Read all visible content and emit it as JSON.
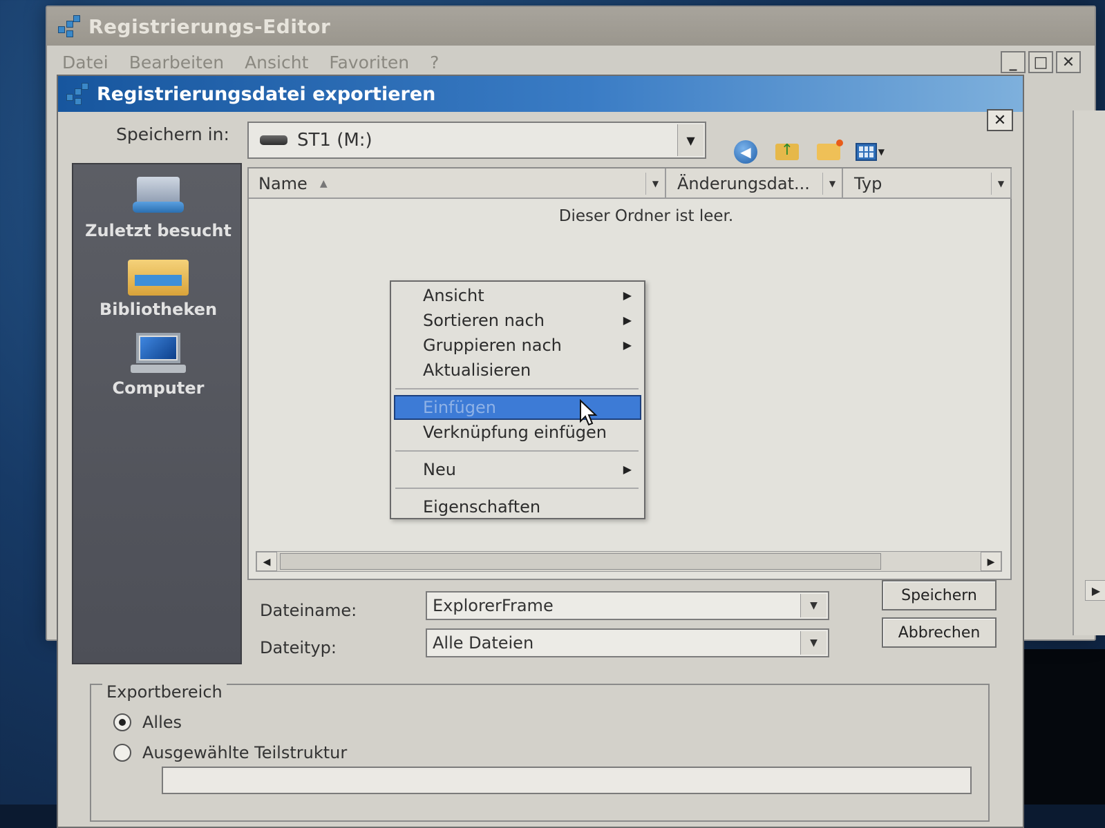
{
  "window": {
    "title": "Registrierungs-Editor",
    "menu": [
      "Datei",
      "Bearbeiten",
      "Ansicht",
      "Favoriten",
      "?"
    ],
    "controls": [
      "_",
      "□",
      "✕"
    ]
  },
  "dialog": {
    "title": "Registrierungsdatei exportieren",
    "close": "✕",
    "save_in_label": "Speichern in:",
    "location": "ST1 (M:)",
    "places": [
      {
        "label": "Zuletzt besucht",
        "icon": "recent-places-icon"
      },
      {
        "label": "Bibliotheken",
        "icon": "libraries-icon"
      },
      {
        "label": "Computer",
        "icon": "computer-icon"
      }
    ],
    "columns": [
      "Name",
      "Änderungsdat...",
      "Typ"
    ],
    "empty_text": "Dieser Ordner ist leer.",
    "context_menu": {
      "items": [
        {
          "label": "Ansicht",
          "submenu": true
        },
        {
          "label": "Sortieren nach",
          "submenu": true
        },
        {
          "label": "Gruppieren nach",
          "submenu": true
        },
        {
          "label": "Aktualisieren",
          "submenu": false
        },
        {
          "label": "Einfügen",
          "submenu": false,
          "disabled": true,
          "highlighted": true
        },
        {
          "label": "Verknüpfung einfügen",
          "submenu": false
        },
        {
          "label": "Neu",
          "submenu": true
        },
        {
          "label": "Eigenschaften",
          "submenu": false
        }
      ]
    },
    "filename_label": "Dateiname:",
    "filename_value": "ExplorerFrame",
    "filetype_label": "Dateityp:",
    "filetype_value": "Alle Dateien",
    "save_button": "Speichern",
    "cancel_button": "Abbrechen",
    "export_range": {
      "legend": "Exportbereich",
      "options": [
        "Alles",
        "Ausgewählte Teilstruktur"
      ],
      "selected": "Alles",
      "subtree_value": ""
    }
  },
  "colors": {
    "title_bar": "#17569e",
    "selection": "#3d7bd6",
    "places_bg": "#5c5e65"
  }
}
